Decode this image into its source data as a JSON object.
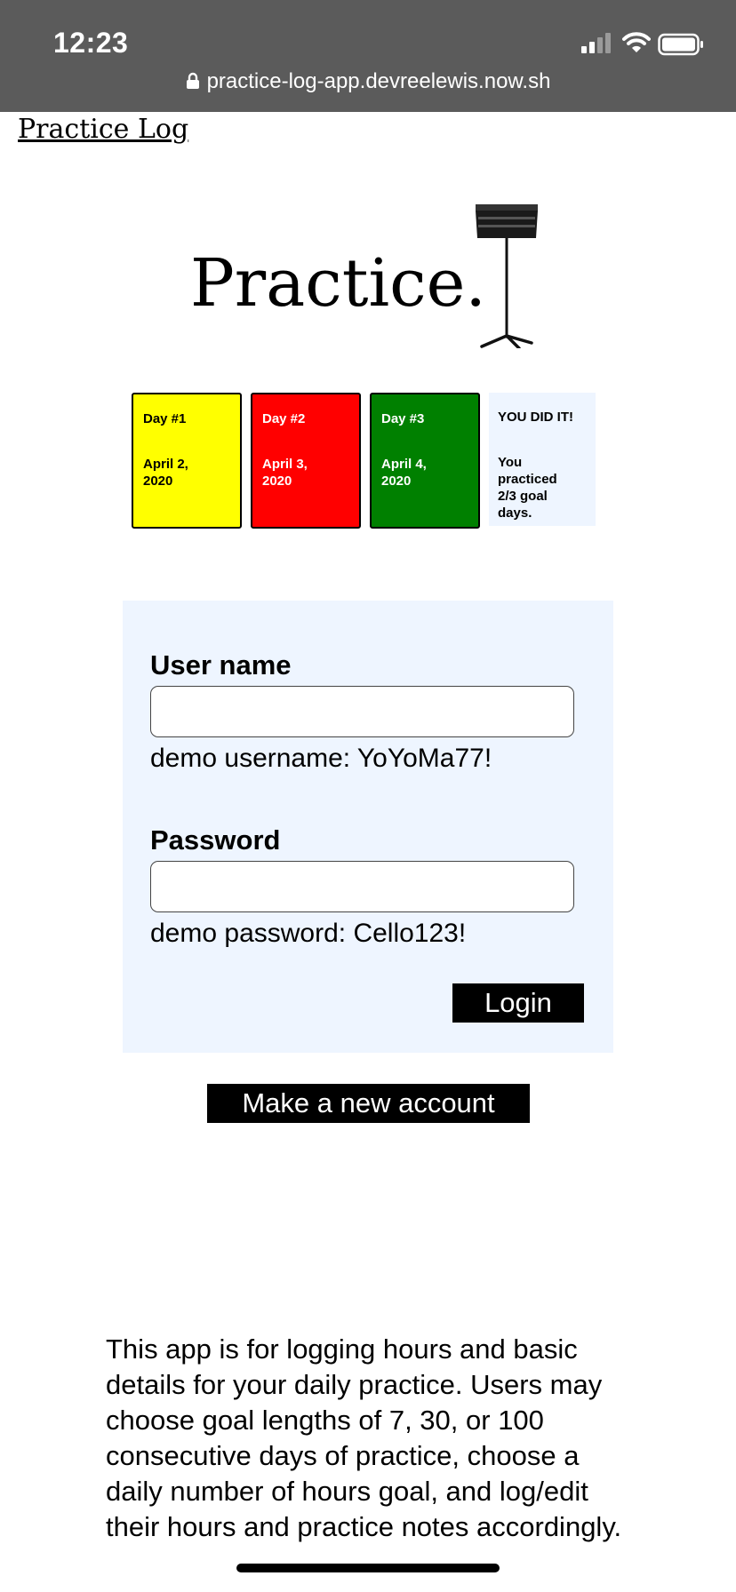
{
  "status_bar": {
    "time": "12:23",
    "url": "practice-log-app.devreelewis.now.sh",
    "icons": [
      "signal-icon",
      "wifi-icon",
      "battery-icon",
      "lock-icon"
    ]
  },
  "app": {
    "title": "Practice Log",
    "hero_title": "Practice.",
    "hero_image": "music-stand-icon"
  },
  "demo_days": [
    {
      "label": "Day #1",
      "date": "April 2, 2020",
      "color": "#ffff00"
    },
    {
      "label": "Day #2",
      "date": "April 3, 2020",
      "color": "#ff0000"
    },
    {
      "label": "Day #3",
      "date": "April 4, 2020",
      "color": "#008000"
    }
  ],
  "result_card": {
    "heading": "YOU DID IT!",
    "message": "You practiced 2/3 goal days."
  },
  "login_form": {
    "username_label": "User name",
    "username_value": "",
    "username_hint": "demo username: YoYoMa77!",
    "password_label": "Password",
    "password_value": "",
    "password_hint": "demo password: Cello123!",
    "login_label": "Login"
  },
  "new_account_label": "Make a new account",
  "about_text": "This app is for logging hours and basic details for your daily practice. Users may choose goal lengths of 7, 30, or 100 consecutive days of practice, choose a daily number of hours goal, and log/edit their hours and practice notes accordingly."
}
